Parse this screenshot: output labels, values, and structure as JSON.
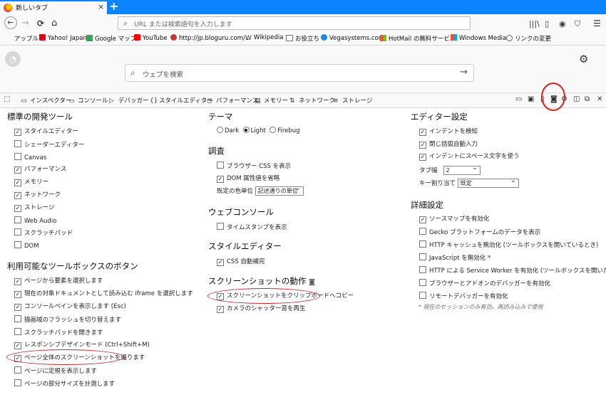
{
  "tab": {
    "title": "新しいタブ",
    "close": "×",
    "new": "+"
  },
  "nav": {
    "back": "←",
    "forward": "→",
    "reload": "C",
    "home": "⌂",
    "url_placeholder": "URL または検索語句を入力します"
  },
  "bookmarks": [
    {
      "label": "アップル",
      "icon": "apple-icon",
      "color": "#333"
    },
    {
      "label": "Yahoo! Japan",
      "icon": "yahoo-icon",
      "color": "#e60012"
    },
    {
      "label": "Google マップ",
      "icon": "maps-icon",
      "color": "#34a853"
    },
    {
      "label": "YouTube",
      "icon": "youtube-icon",
      "color": "#ff0000"
    },
    {
      "label": "http://jp.bloguru.com/...",
      "icon": "bloguru-icon",
      "color": "#c0392b"
    },
    {
      "label": "Wikipedia",
      "icon": "wikipedia-icon",
      "color": "#555"
    },
    {
      "label": "お役立ち",
      "icon": "folder-icon",
      "color": "#777"
    },
    {
      "label": "Vegasystems.com",
      "icon": "vegas-icon",
      "color": "#1e88e5"
    },
    {
      "label": "HotMail の無料サービス",
      "icon": "windows-icon",
      "color": "#f35325"
    },
    {
      "label": "Windows Media",
      "icon": "windows-icon",
      "color": "#f35325"
    },
    {
      "label": "リンクの変更",
      "icon": "link-icon",
      "color": "#666"
    }
  ],
  "newtab": {
    "search_placeholder": "ウェブを検索"
  },
  "devtools": {
    "tabs": [
      {
        "label": "インスペクター",
        "icon": "inspector-icon"
      },
      {
        "label": "コンソール",
        "icon": "console-icon"
      },
      {
        "label": "デバッガー",
        "icon": "debugger-icon"
      },
      {
        "label": "スタイルエディター",
        "icon": "style-editor-icon"
      },
      {
        "label": "パフォーマンス",
        "icon": "performance-icon"
      },
      {
        "label": "メモリー",
        "icon": "memory-icon"
      },
      {
        "label": "ネットワーク",
        "icon": "network-icon"
      },
      {
        "label": "ストレージ",
        "icon": "storage-icon"
      }
    ]
  },
  "settings": {
    "default_tools": {
      "heading": "標準の開発ツール",
      "items": [
        {
          "label": "スタイルエディター",
          "checked": true
        },
        {
          "label": "シェーダーエディター",
          "checked": false
        },
        {
          "label": "Canvas",
          "checked": false
        },
        {
          "label": "パフォーマンス",
          "checked": true
        },
        {
          "label": "メモリー",
          "checked": true
        },
        {
          "label": "ネットワーク",
          "checked": true
        },
        {
          "label": "ストレージ",
          "checked": true
        },
        {
          "label": "Web Audio",
          "checked": false
        },
        {
          "label": "スクラッチパッド",
          "checked": false
        },
        {
          "label": "DOM",
          "checked": false
        }
      ]
    },
    "toolbox_buttons": {
      "heading": "利用可能なツールボックスのボタン",
      "items": [
        {
          "label": "ページから要素を選択します",
          "checked": true
        },
        {
          "label": "現在の対象ドキュメントとして読み込む iframe を選択します",
          "checked": true
        },
        {
          "label": "コンソールペインを表示します (Esc)",
          "checked": true
        },
        {
          "label": "描画域のフラッシュを切り替えます",
          "checked": false
        },
        {
          "label": "スクラッチパッドを開きます",
          "checked": false
        },
        {
          "label": "レスポンシブデザインモード (Ctrl+Shift+M)",
          "checked": true
        },
        {
          "label": "ページ全体のスクリーンショットを撮ります",
          "checked": true
        },
        {
          "label": "ページに定規を表示します",
          "checked": false
        },
        {
          "label": "ページの部分サイズを計測します",
          "checked": false
        }
      ]
    },
    "theme": {
      "heading": "テーマ",
      "options": [
        "Dark",
        "Light",
        "Firebug"
      ],
      "selected": "Light"
    },
    "inspector": {
      "heading": "調査",
      "items": [
        {
          "label": "ブラウザー CSS を表示",
          "checked": false
        },
        {
          "label": "DOM 属性値を省略",
          "checked": true
        }
      ],
      "color_unit_label": "既定の色単位",
      "color_unit_value": "記述通りの単位"
    },
    "web_console": {
      "heading": "ウェブコンソール",
      "items": [
        {
          "label": "タイムスタンプを表示",
          "checked": false
        }
      ]
    },
    "style_editor": {
      "heading": "スタイルエディター",
      "items": [
        {
          "label": "CSS 自動補完",
          "checked": true
        }
      ]
    },
    "screenshot": {
      "heading": "スクリーンショットの動作",
      "items": [
        {
          "label": "スクリーンショットをクリップボードへコピー",
          "checked": true
        },
        {
          "label": "カメラのシャッター音を再生",
          "checked": true
        }
      ]
    },
    "editor": {
      "heading": "エディター設定",
      "items": [
        {
          "label": "インデントを検知",
          "checked": true
        },
        {
          "label": "閉じ括弧自動入力",
          "checked": true
        },
        {
          "label": "インデントにスペース文字を使う",
          "checked": true
        }
      ],
      "tab_size_label": "タブ幅",
      "tab_size_value": "2",
      "keybinding_label": "キー割り当て",
      "keybinding_value": "既定"
    },
    "advanced": {
      "heading": "詳細設定",
      "items": [
        {
          "label": "ソースマップを有効化",
          "checked": true
        },
        {
          "label": "Gecko プラットフォームのデータを表示",
          "checked": false
        },
        {
          "label": "HTTP キャッシュを無効化 (ツールボックスを開いているとき)",
          "checked": false
        },
        {
          "label": "JavaScript を無効化 *",
          "checked": false
        },
        {
          "label": "HTTP による Service Worker を有効化 (ツールボックスを開いたとき)",
          "checked": false
        },
        {
          "label": "ブラウザーとアドオンのデバッガーを有効化",
          "checked": false
        },
        {
          "label": "リモートデバッガーを有効化",
          "checked": false
        }
      ],
      "note": "* 現在のセッションのみ有効。再読み込みで使用"
    }
  }
}
